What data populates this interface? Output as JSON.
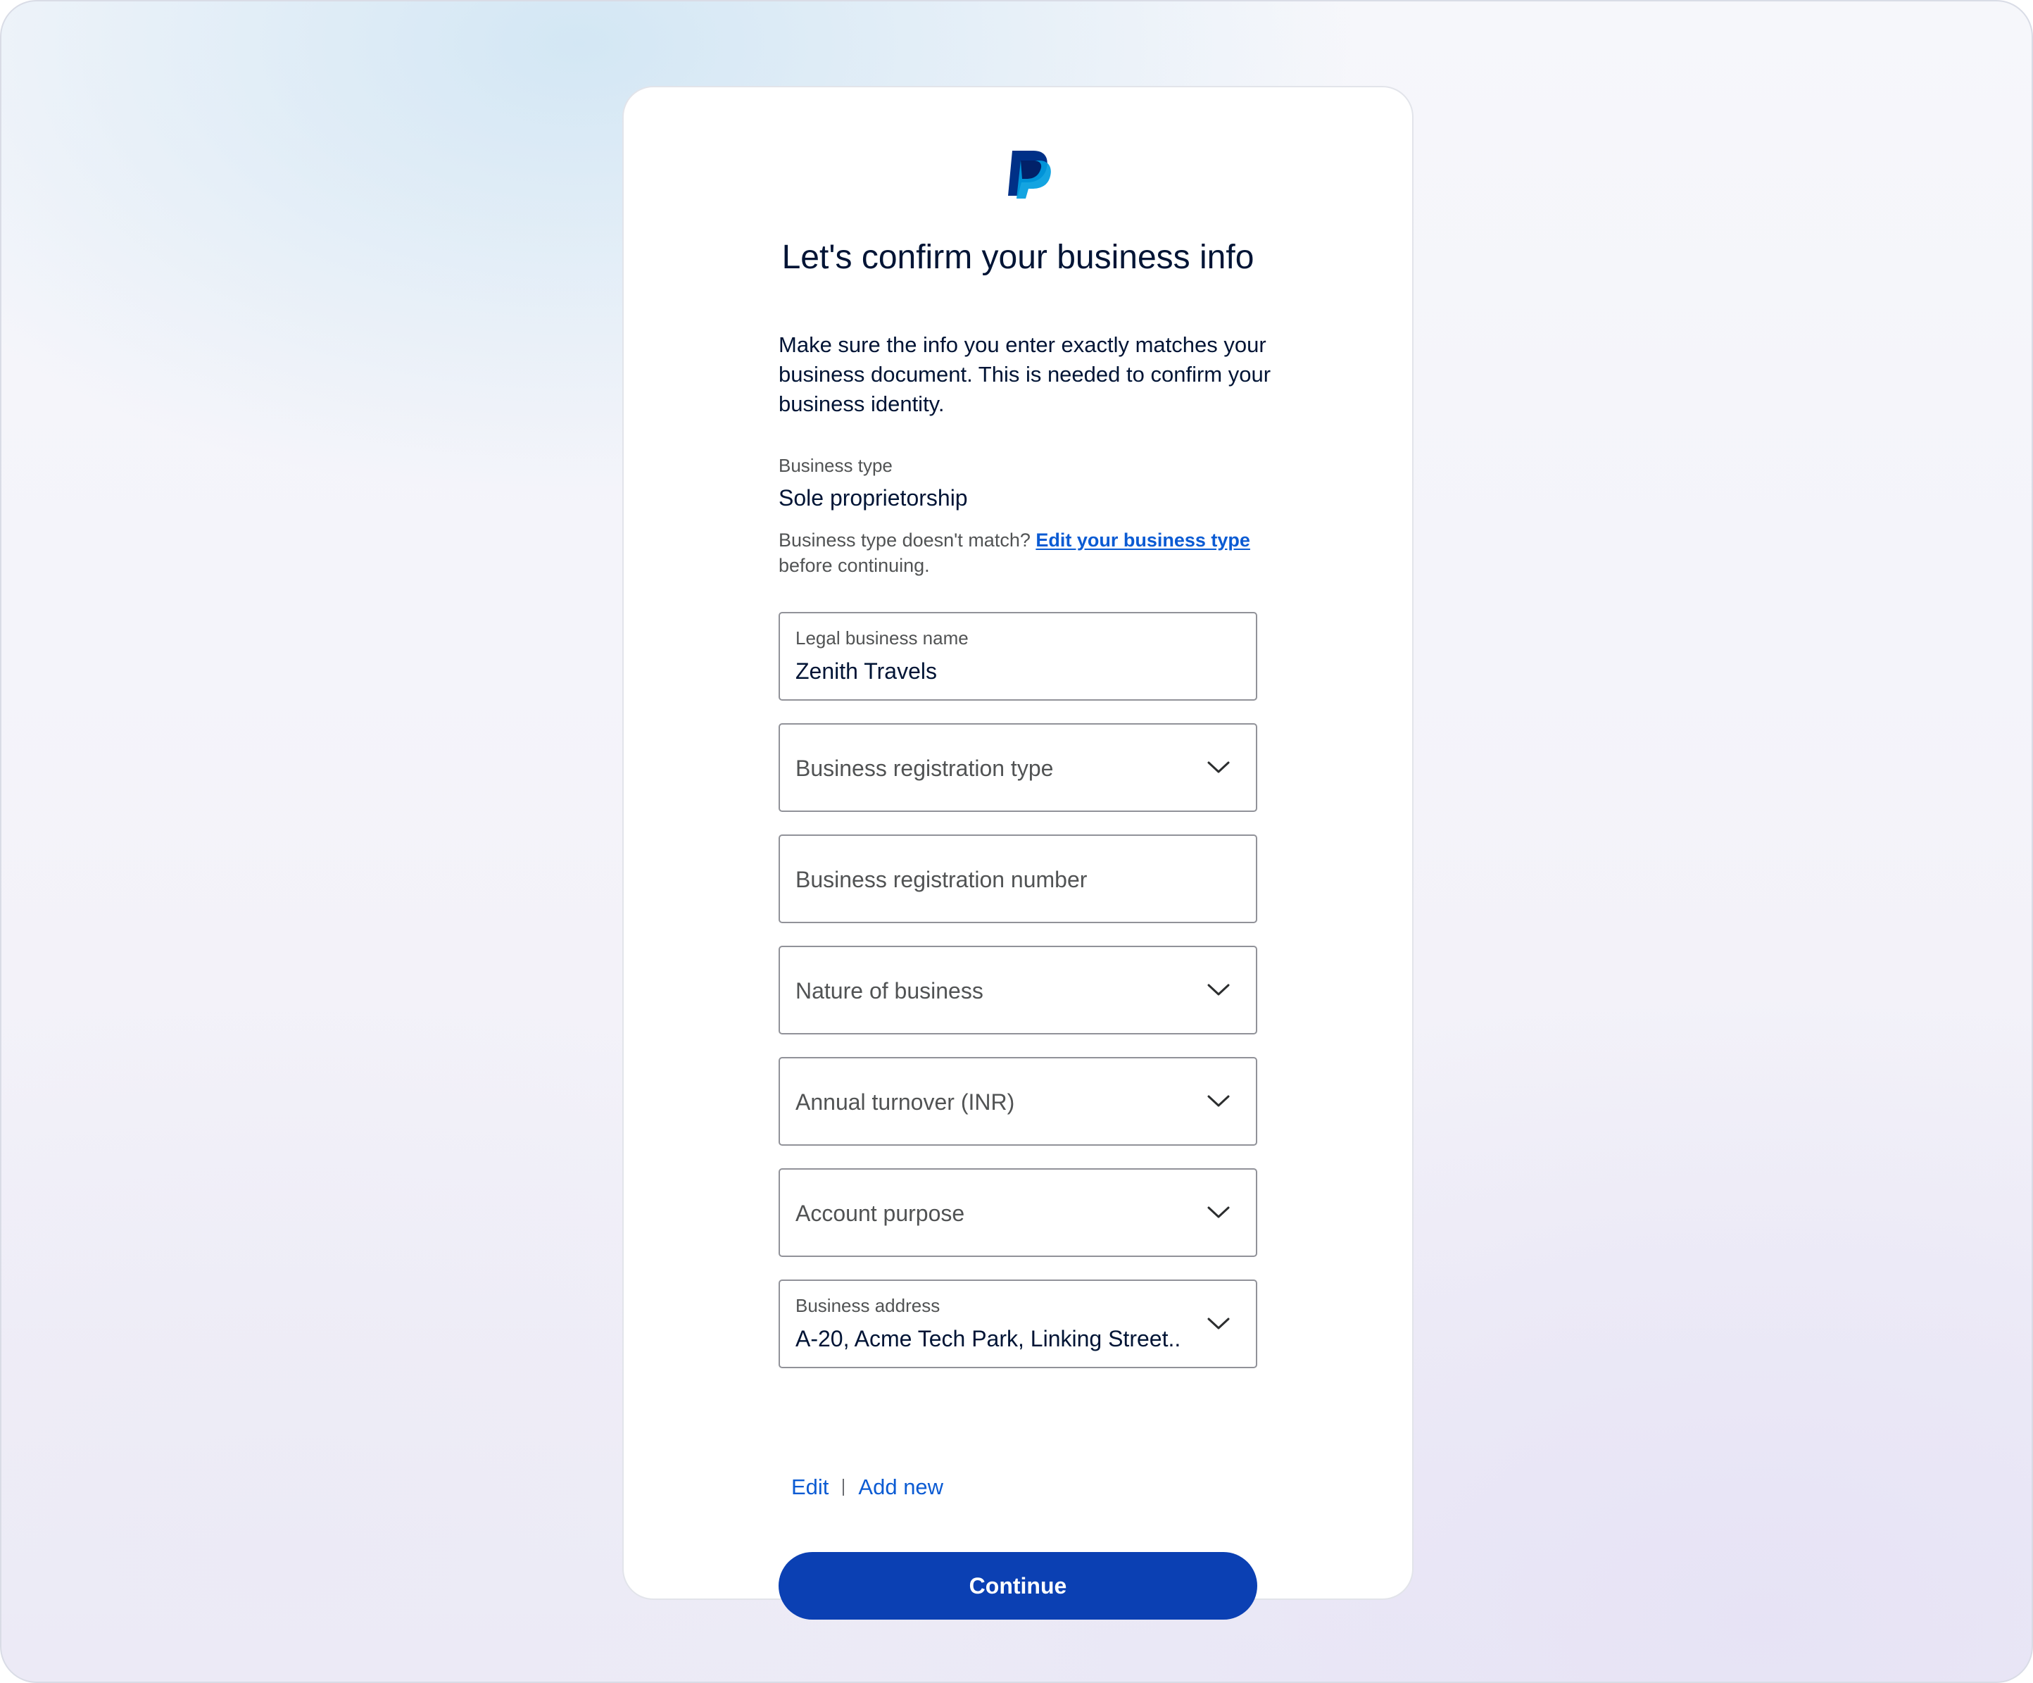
{
  "colors": {
    "primary_button": "#0b40b3",
    "link": "#0b5bd3",
    "text_primary": "#001435",
    "text_secondary": "#515354",
    "field_border": "#919299",
    "logo_dark": "#003087",
    "logo_light": "#009cde"
  },
  "header": {
    "logo_icon": "paypal-logo",
    "title": "Let's confirm your business info",
    "intro": "Make sure the info you enter exactly matches your business document. This is needed to confirm your business identity."
  },
  "business_type": {
    "caption": "Business type",
    "value": "Sole proprietorship",
    "mismatch_prefix": "Business type doesn't match? ",
    "mismatch_link": "Edit your business type ",
    "mismatch_suffix": "before continuing."
  },
  "form": {
    "legal_name": {
      "label": "Legal business name",
      "value": "Zenith Travels"
    },
    "registration_type": {
      "placeholder": "Business registration type",
      "icon": "chevron-down-icon"
    },
    "registration_number": {
      "placeholder": "Business registration number"
    },
    "nature_of_business": {
      "placeholder": "Nature of business",
      "icon": "chevron-down-icon"
    },
    "annual_turnover": {
      "placeholder": "Annual turnover (INR)",
      "icon": "chevron-down-icon"
    },
    "account_purpose": {
      "placeholder": "Account purpose",
      "icon": "chevron-down-icon"
    },
    "business_address": {
      "label": "Business address",
      "value": "A-20, Acme Tech Park, Linking Street..",
      "icon": "chevron-down-icon"
    }
  },
  "address_actions": {
    "edit": "Edit",
    "add_new": "Add new"
  },
  "continue_label": "Continue"
}
